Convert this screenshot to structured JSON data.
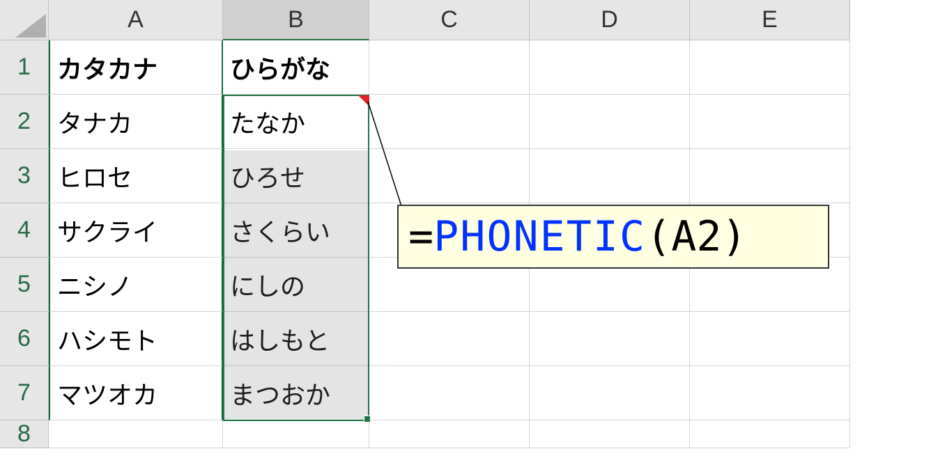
{
  "columns": [
    "A",
    "B",
    "C",
    "D",
    "E"
  ],
  "rows": [
    "1",
    "2",
    "3",
    "4",
    "5",
    "6",
    "7",
    "8"
  ],
  "headers": {
    "A": "カタカナ",
    "B": "ひらがな"
  },
  "data": {
    "A": [
      "タナカ",
      "ヒロセ",
      "サクライ",
      "ニシノ",
      "ハシモト",
      "マツオカ"
    ],
    "B": [
      "たなか",
      "ひろせ",
      "さくらい",
      "にしの",
      "はしもと",
      "まつおか"
    ]
  },
  "formula": {
    "eq": "=",
    "name": "PHONETIC",
    "open": "(",
    "ref": "A2",
    "close": ")"
  },
  "selection": {
    "range": "B2:B7",
    "active": "B2"
  }
}
